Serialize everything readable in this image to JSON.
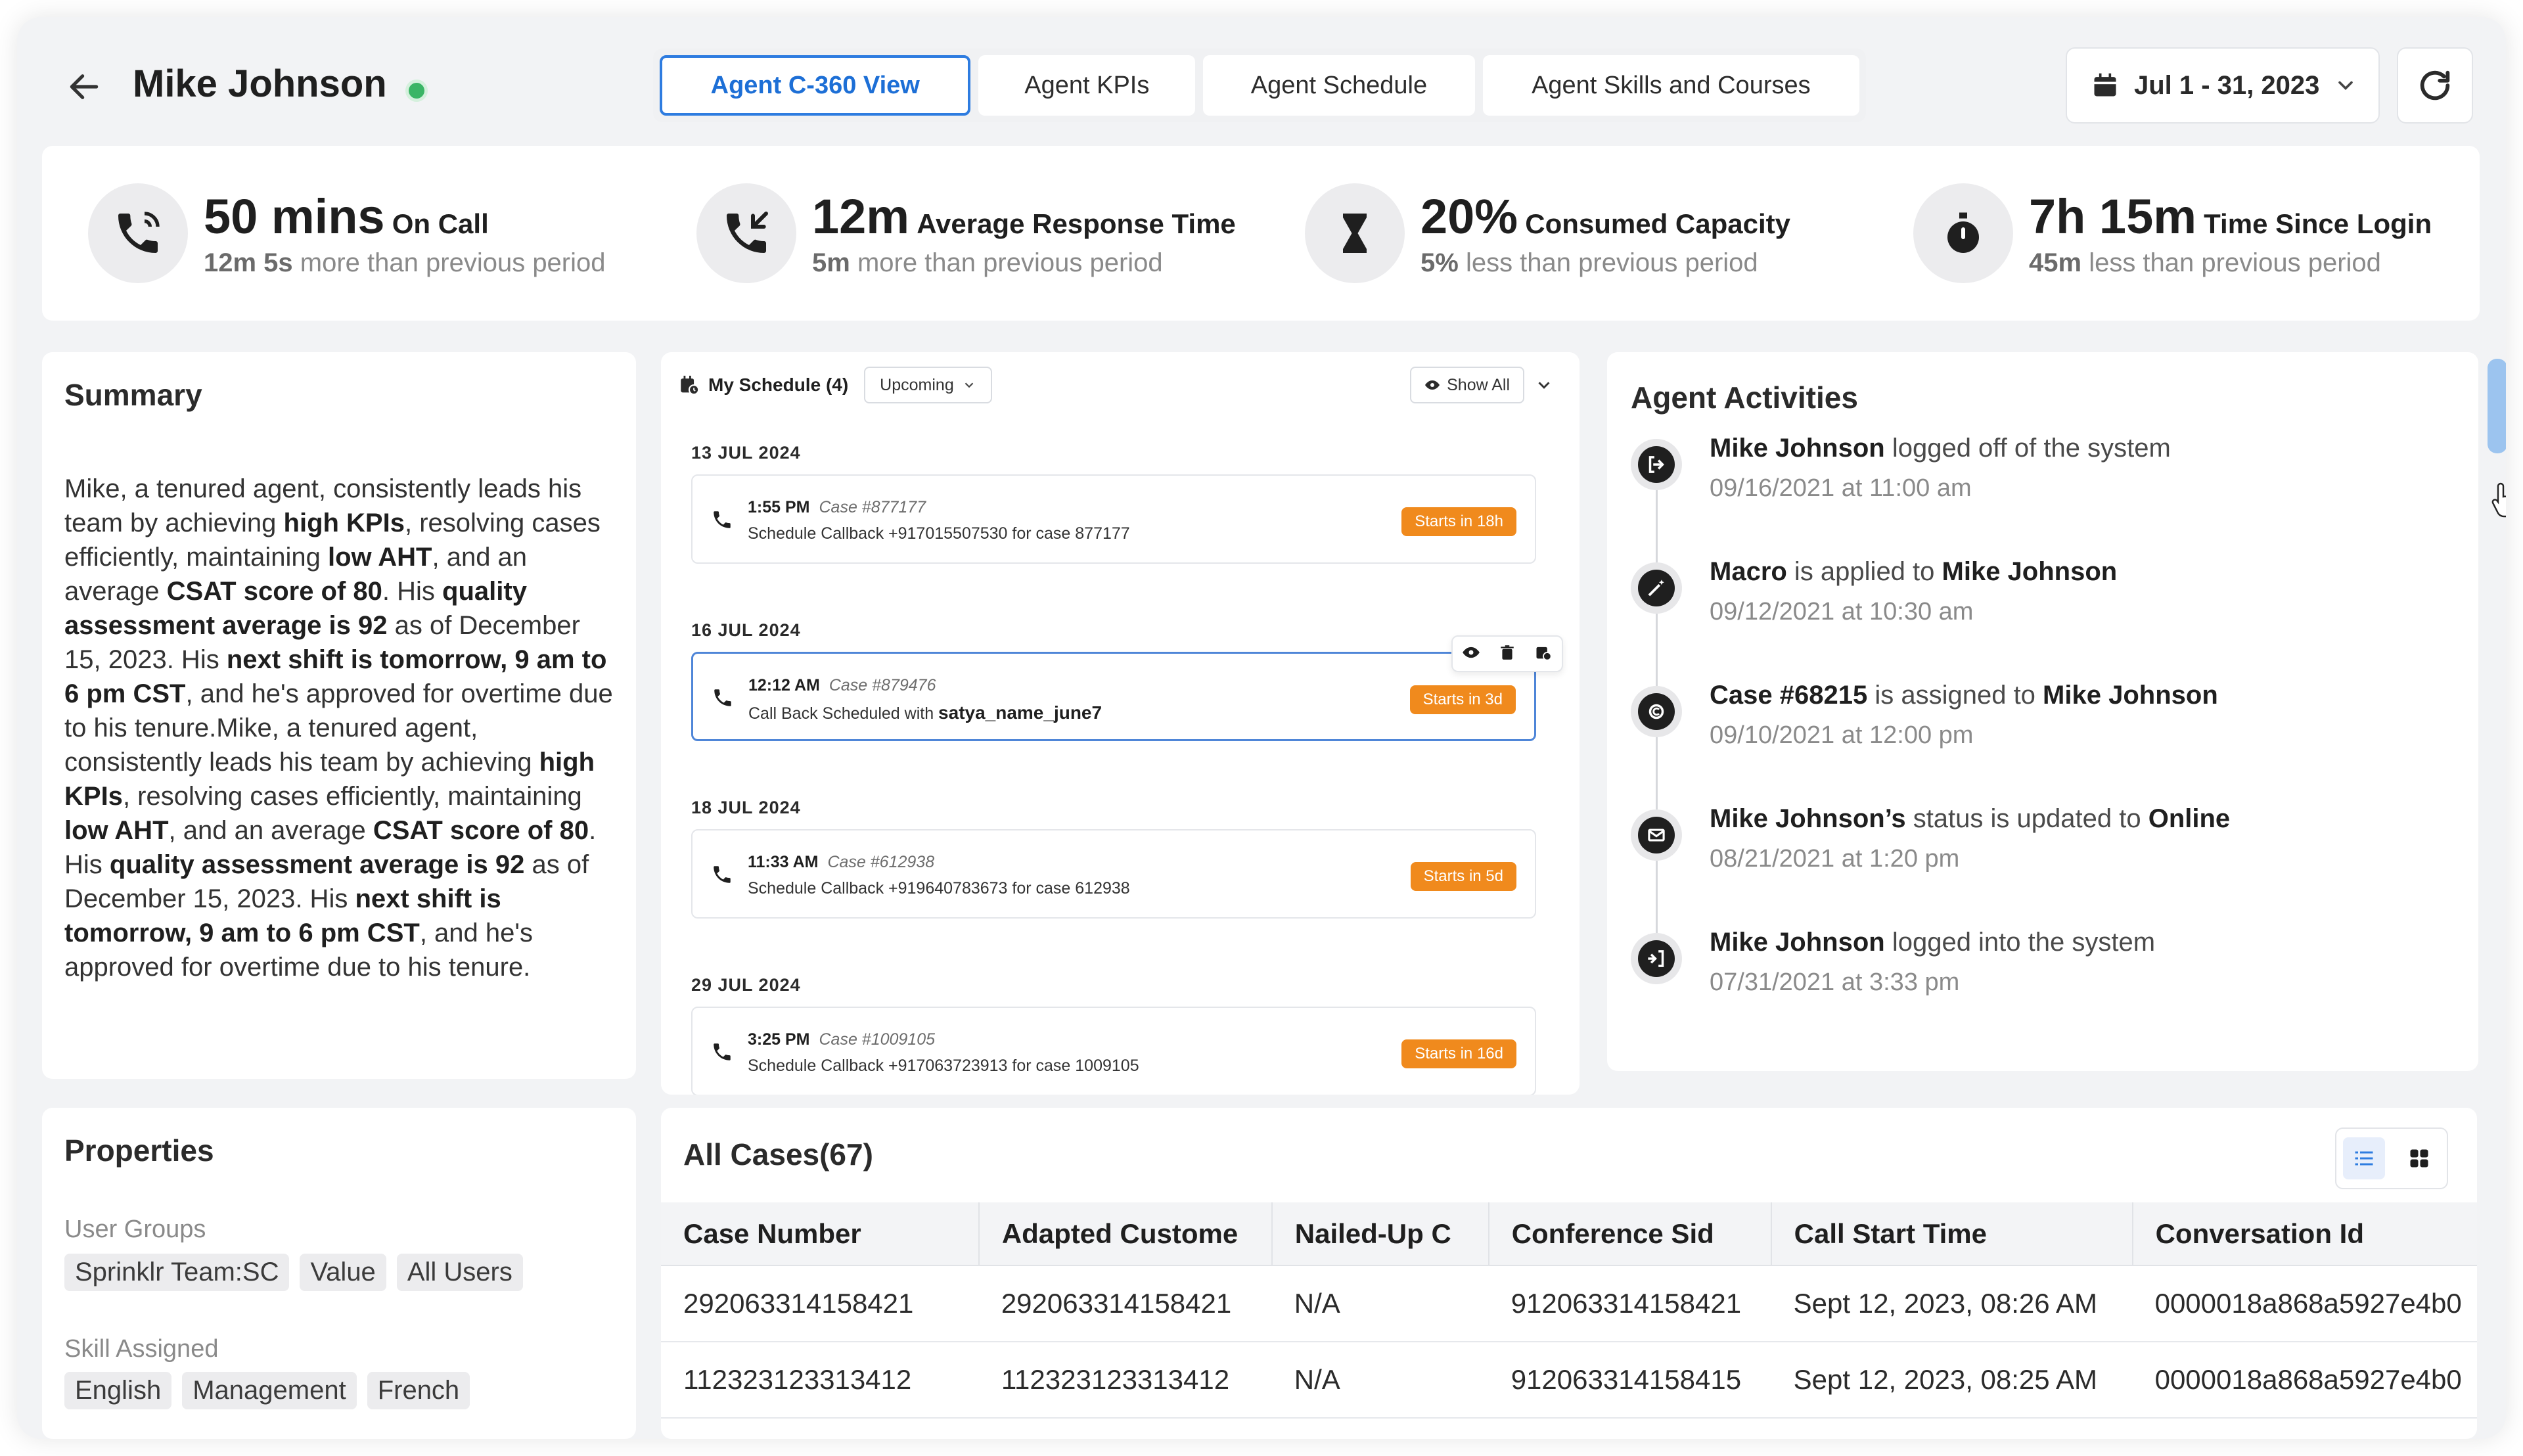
{
  "header": {
    "agent_name": "Mike Johnson",
    "status_color": "#3bb566",
    "tabs": [
      {
        "label": "Agent C-360 View",
        "active": true
      },
      {
        "label": "Agent KPIs",
        "active": false
      },
      {
        "label": "Agent Schedule",
        "active": false
      },
      {
        "label": "Agent Skills and Courses",
        "active": false
      }
    ],
    "date_range": "Jul 1 - 31, 2023"
  },
  "kpis": [
    {
      "icon": "phone-call-icon",
      "value": "50 mins",
      "label": "On Call",
      "delta": "12m 5s",
      "delta_text": "more than previous period"
    },
    {
      "icon": "phone-incoming-icon",
      "value": "12m",
      "label": "Average Response Time",
      "delta": "5m",
      "delta_text": "more than previous period"
    },
    {
      "icon": "hourglass-icon",
      "value": "20%",
      "label": "Consumed Capacity",
      "delta": "5%",
      "delta_text": "less than previous period"
    },
    {
      "icon": "stopwatch-icon",
      "value": "7h 15m",
      "label": "Time Since Login",
      "delta": "45m",
      "delta_text": "less than previous period"
    }
  ],
  "summary": {
    "title": "Summary",
    "segments": [
      {
        "t": "Mike, a tenured agent, consistently leads his team by achieving ",
        "b": false
      },
      {
        "t": "high KPIs",
        "b": true
      },
      {
        "t": ", resolving cases efficiently, maintaining ",
        "b": false
      },
      {
        "t": "low AHT",
        "b": true
      },
      {
        "t": ", and an average ",
        "b": false
      },
      {
        "t": "CSAT score of 80",
        "b": true
      },
      {
        "t": ". His ",
        "b": false
      },
      {
        "t": "quality assessment average is 92",
        "b": true
      },
      {
        "t": " as of December 15, 2023. His ",
        "b": false
      },
      {
        "t": "next shift is tomorrow, 9 am to 6 pm CST",
        "b": true
      },
      {
        "t": ", and he's approved for overtime due to his tenure.Mike, a tenured agent, consistently leads his team by achieving ",
        "b": false
      },
      {
        "t": "high KPIs",
        "b": true
      },
      {
        "t": ", resolving cases efficiently, maintaining ",
        "b": false
      },
      {
        "t": "low AHT",
        "b": true
      },
      {
        "t": ", and an average ",
        "b": false
      },
      {
        "t": "CSAT score of 80",
        "b": true
      },
      {
        "t": ". His ",
        "b": false
      },
      {
        "t": "quality assessment average is 92",
        "b": true
      },
      {
        "t": " as of December 15, 2023. His ",
        "b": false
      },
      {
        "t": "next shift is tomorrow, 9 am to 6 pm CST",
        "b": true
      },
      {
        "t": ", and he's approved for overtime due to his tenure.",
        "b": false
      }
    ]
  },
  "schedule": {
    "title": "My Schedule (4)",
    "filter": "Upcoming",
    "show_all": "Show All",
    "groups": [
      {
        "date": "13 JUL 2024",
        "time": "1:55 PM",
        "case": "Case #877177",
        "desc": "Schedule Callback +917015507530 for case 877177",
        "bold": "",
        "badge": "Starts in 18h",
        "selected": false
      },
      {
        "date": "16 JUL 2024",
        "time": "12:12 AM",
        "case": "Case #879476",
        "desc": "Call Back Scheduled with ",
        "bold": "satya_name_june7",
        "badge": "Starts in 3d",
        "selected": true
      },
      {
        "date": "18 JUL 2024",
        "time": "11:33 AM",
        "case": "Case #612938",
        "desc": "Schedule Callback +919640783673 for case 612938",
        "bold": "",
        "badge": "Starts in 5d",
        "selected": false
      },
      {
        "date": "29 JUL 2024",
        "time": "3:25 PM",
        "case": "Case #1009105",
        "desc": "Schedule Callback +917063723913 for case 1009105",
        "bold": "",
        "badge": "Starts in 16d",
        "selected": false
      }
    ],
    "badge_color": "#f08a1d"
  },
  "activities": {
    "title": "Agent Activities",
    "items": [
      {
        "icon": "logout-icon",
        "parts": [
          {
            "t": "Mike Johnson",
            "b": true
          },
          {
            "t": " logged off of the system",
            "b": false
          }
        ],
        "date": "09/16/2021 at 11:00 am"
      },
      {
        "icon": "magic-wand-icon",
        "parts": [
          {
            "t": "Macro",
            "b": true
          },
          {
            "t": " is applied to ",
            "b": false
          },
          {
            "t": "Mike Johnson",
            "b": true
          }
        ],
        "date": "09/12/2021 at 10:30 am"
      },
      {
        "icon": "case-icon",
        "parts": [
          {
            "t": "Case #68215",
            "b": true
          },
          {
            "t": " is assigned to ",
            "b": false
          },
          {
            "t": "Mike Johnson",
            "b": true
          }
        ],
        "date": "09/10/2021 at 12:00 pm"
      },
      {
        "icon": "mail-icon",
        "parts": [
          {
            "t": "Mike Johnson’s",
            "b": true
          },
          {
            "t": " status is updated to ",
            "b": false
          },
          {
            "t": "Online",
            "b": true
          }
        ],
        "date": "08/21/2021 at 1:20 pm"
      },
      {
        "icon": "login-icon",
        "parts": [
          {
            "t": "Mike Johnson",
            "b": true
          },
          {
            "t": " logged into the system",
            "b": false
          }
        ],
        "date": "07/31/2021 at 3:33 pm"
      }
    ]
  },
  "properties": {
    "title": "Properties",
    "user_groups_label": "User Groups",
    "user_groups": [
      "Sprinklr Team:SC",
      "Value",
      "All Users"
    ],
    "skills_label": "Skill Assigned",
    "skills": [
      "English",
      "Management",
      "French"
    ]
  },
  "cases": {
    "title": "All Cases(67)",
    "columns": [
      "Case Number",
      "Adapted Custome",
      "Nailed-Up C",
      "Conference Sid",
      "Call Start Time",
      "Conversation Id"
    ],
    "rows": [
      [
        "292063314158421",
        "292063314158421",
        "N/A",
        "912063314158421",
        "Sept 12, 2023, 08:26 AM",
        "0000018a868a5927e4b0"
      ],
      [
        "112323123313412",
        "112323123313412",
        "N/A",
        "912063314158415",
        "Sept 12, 2023, 08:25 AM",
        "0000018a868a5927e4b0"
      ]
    ]
  }
}
